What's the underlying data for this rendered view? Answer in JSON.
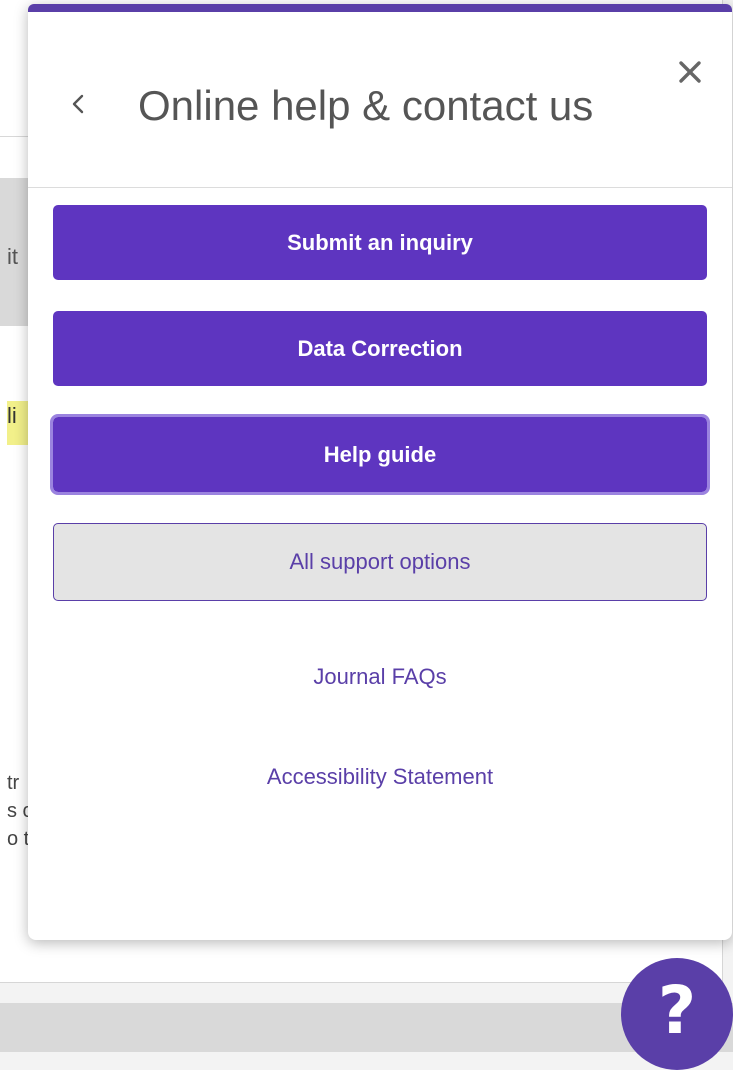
{
  "background": {
    "fragments": [
      "it",
      "li",
      "tr",
      "s c",
      "o t"
    ]
  },
  "panel": {
    "title": "Online help & contact us",
    "back_icon": "chevron-left-icon",
    "close_icon": "close-icon",
    "buttons": [
      {
        "label": "Submit an inquiry",
        "style": "primary"
      },
      {
        "label": "Data Correction",
        "style": "primary"
      },
      {
        "label": "Help guide",
        "style": "primary-focused"
      },
      {
        "label": "All support options",
        "style": "secondary"
      }
    ],
    "links": [
      {
        "label": "Journal FAQs"
      },
      {
        "label": "Accessibility Statement"
      }
    ]
  },
  "help_button": {
    "label": "?",
    "icon": "question-mark-icon"
  },
  "colors": {
    "accent": "#5e35c0",
    "accent_dark": "#5a3fa8",
    "secondary_bg": "#e4e4e4",
    "highlight": "#f2f08a"
  }
}
